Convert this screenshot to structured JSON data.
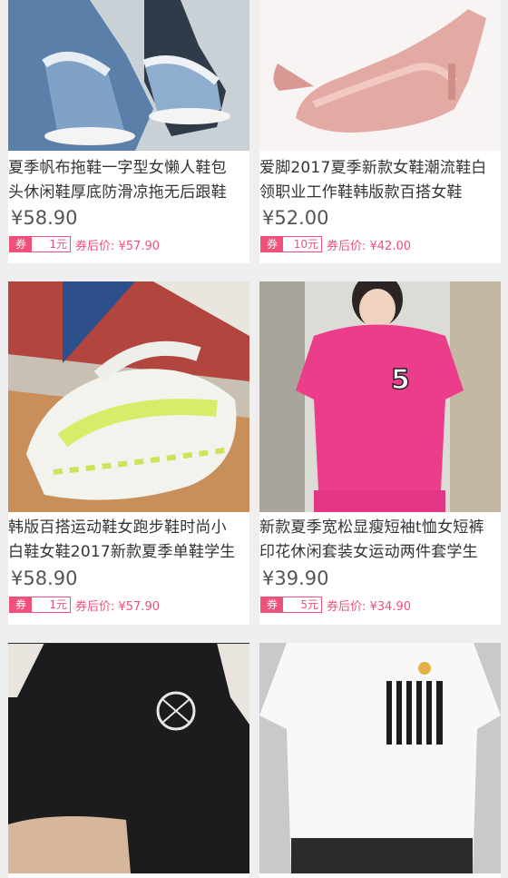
{
  "products": [
    {
      "title_line1": "夏季帆布拖鞋一字型女懒人鞋包",
      "title_line2": "头休闲鞋厚底防滑凉拖无后跟鞋",
      "price": "¥58.90",
      "coupon_tag": "券",
      "coupon_value": "1元",
      "after_coupon": "券后价: ¥57.90",
      "image": "denim-fringe-slippers"
    },
    {
      "title_line1": "爱脚2017夏季新款女鞋潮流鞋白",
      "title_line2": "领职业工作鞋韩版款百搭女鞋",
      "price": "¥52.00",
      "coupon_tag": "券",
      "coupon_value": "10元",
      "after_coupon": "券后价: ¥42.00",
      "image": "pink-pumps"
    },
    {
      "title_line1": "韩版百搭运动鞋女跑步鞋时尚小",
      "title_line2": "白鞋女鞋2017新款夏季单鞋学生",
      "price": "¥58.90",
      "coupon_tag": "券",
      "coupon_value": "1元",
      "after_coupon": "券后价: ¥57.90",
      "image": "white-sneakers"
    },
    {
      "title_line1": "新款夏季宽松显瘦短袖t恤女短裤",
      "title_line2": "印花休闲套装女运动两件套学生",
      "price": "¥39.90",
      "coupon_tag": "券",
      "coupon_value": "5元",
      "after_coupon": "券后价: ¥34.90",
      "image": "pink-tshirt-set"
    },
    {
      "image": "black-tshirt"
    },
    {
      "image": "white-striped-tshirt"
    }
  ],
  "colors": {
    "accent": "#f0507a",
    "background": "#efefef"
  }
}
